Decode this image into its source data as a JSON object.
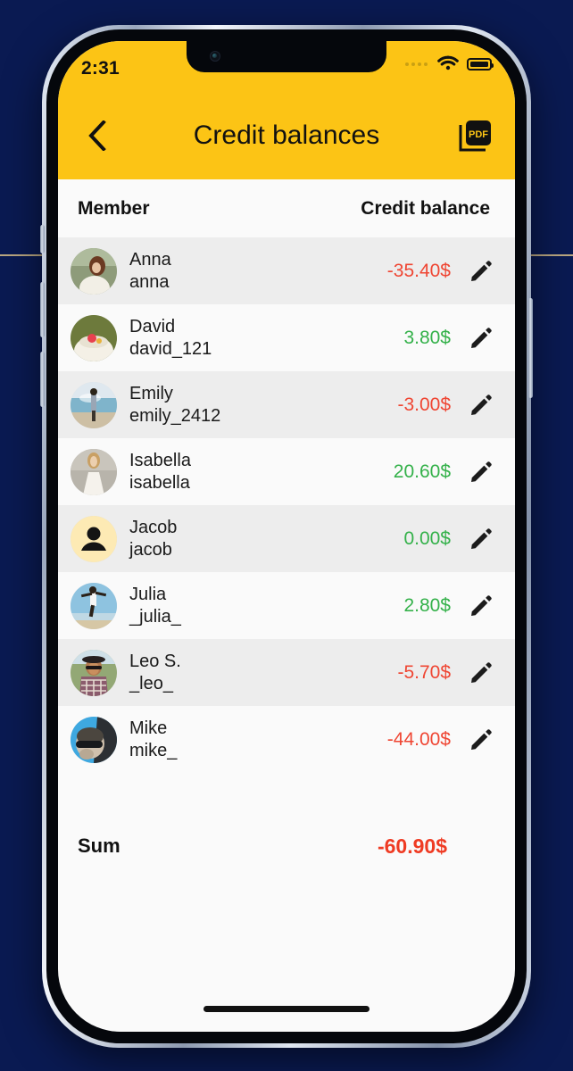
{
  "theme": {
    "background": "#0a1a52",
    "accent_yellow": "#fcc415",
    "negative": "#ef4633",
    "positive": "#34b14a",
    "sum_negative": "#ef3b23",
    "row_alt": "#ededed",
    "row_base": "#fafafa"
  },
  "status_bar": {
    "time": "2:31",
    "signal_icon": "signal-dots-icon",
    "wifi_icon": "wifi-icon",
    "battery_icon": "battery-full-icon"
  },
  "navbar": {
    "back_icon": "chevron-left-icon",
    "title": "Credit balances",
    "action_icon": "pdf-export-icon",
    "action_label": "PDF"
  },
  "table": {
    "columns": {
      "member": "Member",
      "balance": "Credit balance"
    },
    "rows": [
      {
        "name": "Anna",
        "handle": "anna",
        "amount": "-35.40$",
        "sign": "neg",
        "avatar": "photo",
        "edit_icon": "pencil-icon"
      },
      {
        "name": "David",
        "handle": "david_121",
        "amount": "3.80$",
        "sign": "pos",
        "avatar": "photo",
        "edit_icon": "pencil-icon"
      },
      {
        "name": "Emily",
        "handle": "emily_2412",
        "amount": "-3.00$",
        "sign": "neg",
        "avatar": "photo",
        "edit_icon": "pencil-icon"
      },
      {
        "name": "Isabella",
        "handle": "isabella",
        "amount": "20.60$",
        "sign": "pos",
        "avatar": "photo",
        "edit_icon": "pencil-icon"
      },
      {
        "name": "Jacob",
        "handle": "jacob",
        "amount": "0.00$",
        "sign": "pos",
        "avatar": "default-person",
        "edit_icon": "pencil-icon"
      },
      {
        "name": "Julia",
        "handle": "_julia_",
        "amount": "2.80$",
        "sign": "pos",
        "avatar": "photo",
        "edit_icon": "pencil-icon"
      },
      {
        "name": "Leo S.",
        "handle": "_leo_",
        "amount": "-5.70$",
        "sign": "neg",
        "avatar": "photo",
        "edit_icon": "pencil-icon"
      },
      {
        "name": "Mike",
        "handle": "mike_",
        "amount": "-44.00$",
        "sign": "neg",
        "avatar": "photo",
        "edit_icon": "pencil-icon"
      }
    ],
    "summary": {
      "label": "Sum",
      "value": "-60.90$"
    }
  }
}
